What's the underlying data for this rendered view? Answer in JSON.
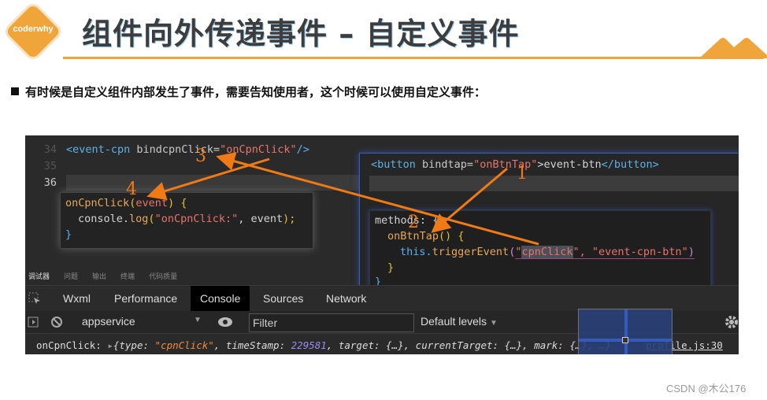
{
  "header": {
    "logo_text": "coderwhy",
    "title": "组件向外传递事件 – 自定义事件",
    "accent_color": "#f0a53a"
  },
  "bullet": "有时候是自定义组件内部发生了事件，需要告知使用者，这个时候可以使用自定义事件：",
  "editor": {
    "line_numbers": [
      "34",
      "35",
      "36"
    ],
    "line34": {
      "open": "<event-cpn",
      "attr": " bindcpnClick=",
      "value": "\"onCpnClick\"",
      "close": "/>"
    },
    "popup_left": {
      "fn": "onCpnClick",
      "param": "event",
      "body_obj": "console.",
      "body_fn": "log",
      "body_str": "\"onCpnClick:\"",
      "body_arg": ", event",
      "body_end": ");",
      "close": "}"
    },
    "panel_right": {
      "tag_open": "<button",
      "attr": " bindtap=",
      "value": "\"onBtnTap\"",
      "text": ">event-btn",
      "tag_close": "</button>",
      "methods": "methods: {",
      "method_name": "onBtnTap",
      "method_parens": "() {",
      "this": "this.",
      "trigger": "triggerEvent",
      "arg1_quote": "\"",
      "arg1": "cpnClick",
      "arg2": "\", \"event-cpn-btn\"",
      "paren_close": ")",
      "inner_close": "}",
      "outer_close": "}"
    },
    "annotations": [
      "1",
      "2",
      "3",
      "4"
    ],
    "annotation_color": "#f07a16"
  },
  "devtools": {
    "top_tabs": [
      "调试器",
      "问题",
      "输出",
      "终端",
      "代码质量"
    ],
    "active_top_tab": "调试器",
    "tabs": [
      "Wxml",
      "Performance",
      "Console",
      "Sources",
      "Network"
    ],
    "active_tab": "Console",
    "context_select": "appservice",
    "filter_placeholder": "Filter",
    "levels_select": "Default levels",
    "console_prefix": "onCpnClick: ",
    "console_obj_open": "{type: ",
    "console_type": "\"cpnClick\"",
    "console_ts_label": ", timeStamp: ",
    "console_ts": "229581",
    "console_rest": ", target: {…}, currentTarget: {…}, mark: {…}, …}",
    "console_source": "profile.js:30"
  },
  "watermark": "CSDN @木公176"
}
